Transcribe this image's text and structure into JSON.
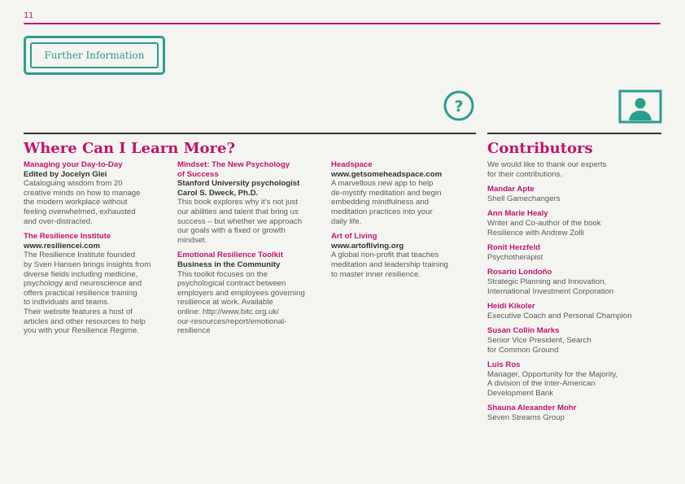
{
  "page": {
    "number": "11"
  },
  "badge": {
    "label": "Further Information"
  },
  "icons": {
    "help": "question-mark-icon",
    "profile": "person-icon"
  },
  "colors": {
    "accent": "#c0136f",
    "teal": "#2a9d8f",
    "text": "#5a5a5a",
    "dark": "#333333"
  },
  "learn": {
    "heading": "Where Can I Learn More?",
    "columns": [
      [
        {
          "title": "Managing your Day-to-Day",
          "subtitle": "Edited by Jocelyn Glei",
          "body": "Cataloguing wisdom from 20\ncreative minds on how to manage\nthe modern workplace without\nfeeling overwhelmed, exhausted\nand over-distracted."
        },
        {
          "title": "The Resilience Institute",
          "subtitle": "www.resiliencei.com",
          "body": "The Resilience Institute founded\nby Sven Hansen brings insights from\ndiverse fields including medicine,\npsychology and neuroscience and\noffers practical resilience training\nto individuals and teams.\nTheir website features a host of\narticles and other resources to help\nyou with your Resilience Regime."
        }
      ],
      [
        {
          "title": "Mindset: The New Psychology\nof Success",
          "subtitle": "Stanford University psychologist\nCarol S. Dweck, Ph.D.",
          "body": "This book explores why it’s not just\nour abilities and talent that bring us\nsuccess – but whether we approach\nour goals with a fixed or growth\nmindset."
        },
        {
          "title": "Emotional Resilience Toolkit",
          "subtitle": "Business in the Community",
          "body": "This toolkit focuses on the\npsychological contract between\nemployers and employees governing\nresilience at work. Available\nonline: http://www.bitc.org.uk/\nour-resources/report/emotional-\nresilience"
        }
      ],
      [
        {
          "title": "Headspace",
          "subtitle": "www.getsomeheadspace.com",
          "body": "A marvellous new app to help\nde-mystify meditation and begin\nembedding mindfulness and\nmeditation practices into your\ndaily life."
        },
        {
          "title": "Art of Living",
          "subtitle": "www.artofliving.org",
          "body": "A global non-profit that teaches\nmeditation and leadership training\nto master inner resilience."
        }
      ]
    ]
  },
  "contributors": {
    "heading": "Contributors",
    "intro": "We would like to thank our experts\nfor their contributions.",
    "people": [
      {
        "name": "Mandar Apte",
        "role": "Shell Gamechangers"
      },
      {
        "name": "Ann Marie Healy",
        "role": "Writer and Co-author of the book\nResilience with Andrew Zolli"
      },
      {
        "name": "Ronit Herzfeld",
        "role": "Psychotherapist"
      },
      {
        "name": "Rosario Londoño",
        "role": "Strategic Planning and Innovation,\nInternational Investment Corporation"
      },
      {
        "name": "Heidi Kikoler",
        "role": "Executive Coach and Personal Champion"
      },
      {
        "name": "Susan Collin Marks",
        "role": "Senior Vice President, Search\nfor Common Ground"
      },
      {
        "name": "Luis Ros",
        "role": "Manager, Opportunity for the Majority,\nA division of the Inter-American\nDevelopment Bank"
      },
      {
        "name": "Shauna Alexander Mohr",
        "role": "Seven Streams Group"
      }
    ]
  }
}
